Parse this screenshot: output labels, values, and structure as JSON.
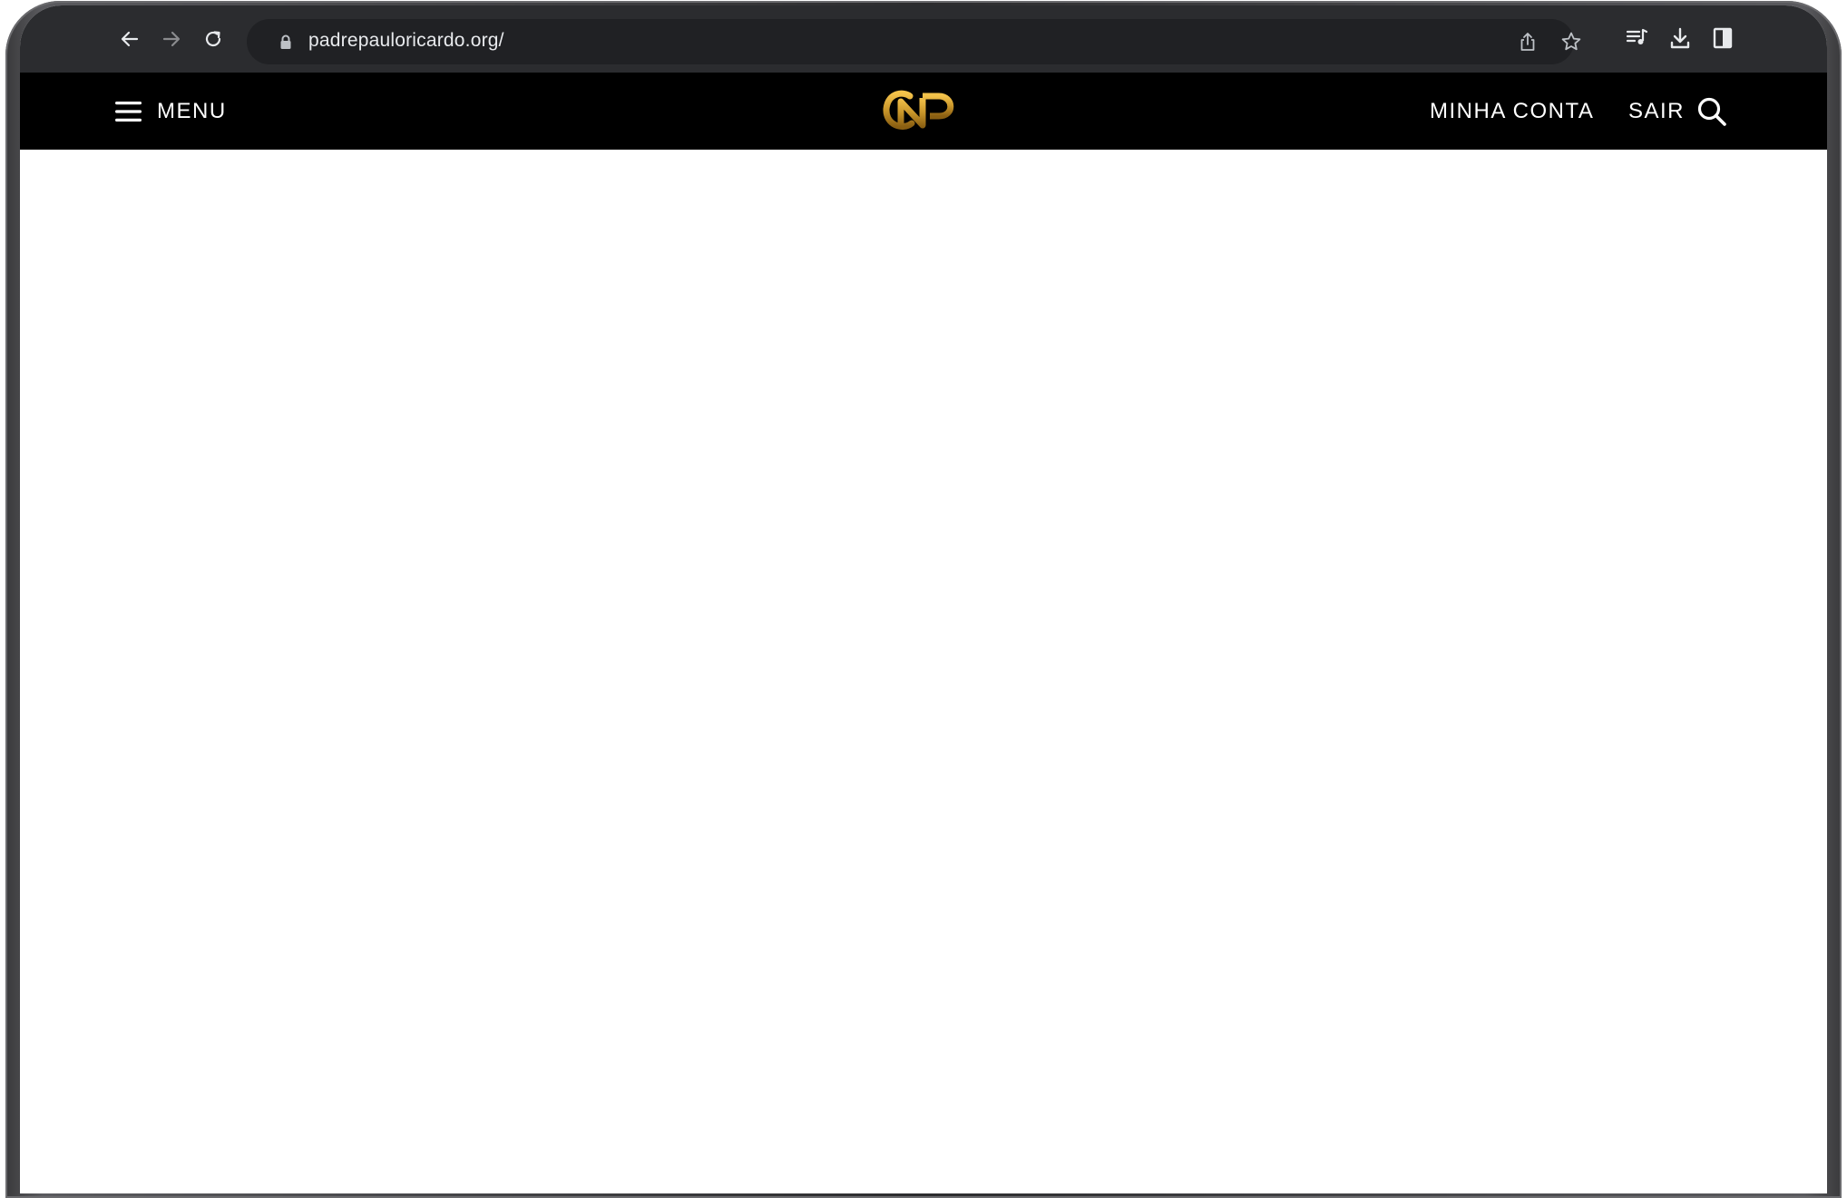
{
  "browser": {
    "url": "padrepauloricardo.org/"
  },
  "header": {
    "menu_label": "MENU",
    "account_label": "MINHA CONTA",
    "logout_label": "SAIR"
  },
  "colors": {
    "header_bg": "#000000",
    "logo_gold": "#c9962a",
    "chrome_bg": "#2b2c2f",
    "omnibox_bg": "#202124"
  }
}
